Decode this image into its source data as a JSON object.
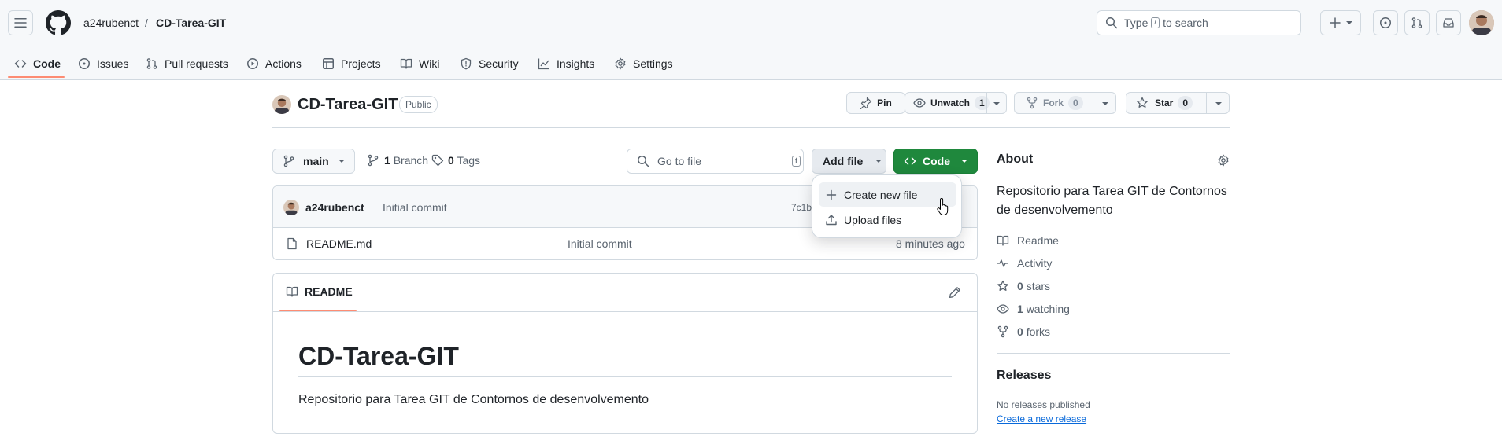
{
  "header": {
    "owner": "a24rubenct",
    "separator": "/",
    "repo": "CD-Tarea-GIT",
    "search_prefix": "Type",
    "search_key": "/",
    "search_suffix": "to search"
  },
  "tabs": [
    {
      "label": "Code",
      "icon": "code-icon",
      "selected": true
    },
    {
      "label": "Issues",
      "icon": "issue-icon"
    },
    {
      "label": "Pull requests",
      "icon": "pull-request-icon"
    },
    {
      "label": "Actions",
      "icon": "play-icon"
    },
    {
      "label": "Projects",
      "icon": "table-icon"
    },
    {
      "label": "Wiki",
      "icon": "book-icon"
    },
    {
      "label": "Security",
      "icon": "shield-icon"
    },
    {
      "label": "Insights",
      "icon": "graph-icon"
    },
    {
      "label": "Settings",
      "icon": "gear-icon"
    }
  ],
  "repo_header": {
    "name": "CD-Tarea-GIT",
    "visibility": "Public",
    "pin": "Pin",
    "unwatch": "Unwatch",
    "watch_count": "1",
    "fork": "Fork",
    "fork_count": "0",
    "star": "Star",
    "star_count": "0"
  },
  "toolbar": {
    "branch": "main",
    "branches_count": "1",
    "branches_label": "Branch",
    "tags_count": "0",
    "tags_label": "Tags",
    "goto_placeholder": "Go to file",
    "goto_key": "t",
    "add_file": "Add file",
    "code": "Code"
  },
  "commit": {
    "author": "a24rubenct",
    "message": "Initial commit",
    "hash": "7c1b"
  },
  "files": [
    {
      "name": "README.md",
      "message": "Initial commit",
      "age": "8 minutes ago"
    }
  ],
  "readme": {
    "tab": "README",
    "title": "CD-Tarea-GIT",
    "body": "Repositorio para Tarea GIT de Contornos de desenvolvemento"
  },
  "dropdown": {
    "items": [
      {
        "label": "Create new file",
        "icon": "plus-icon"
      },
      {
        "label": "Upload files",
        "icon": "upload-icon"
      }
    ]
  },
  "about": {
    "title": "About",
    "description": "Repositorio para Tarea GIT de Contornos de desenvolvemento",
    "readme": "Readme",
    "activity": "Activity",
    "stars_count": "0",
    "stars_label": "stars",
    "watching_count": "1",
    "watching_label": "watching",
    "forks_count": "0",
    "forks_label": "forks"
  },
  "releases": {
    "title": "Releases",
    "none": "No releases published",
    "create": "Create a new release"
  },
  "colors": {
    "primary": "#1f883d",
    "accent_underline": "#fd8c73",
    "link": "#0969da"
  }
}
